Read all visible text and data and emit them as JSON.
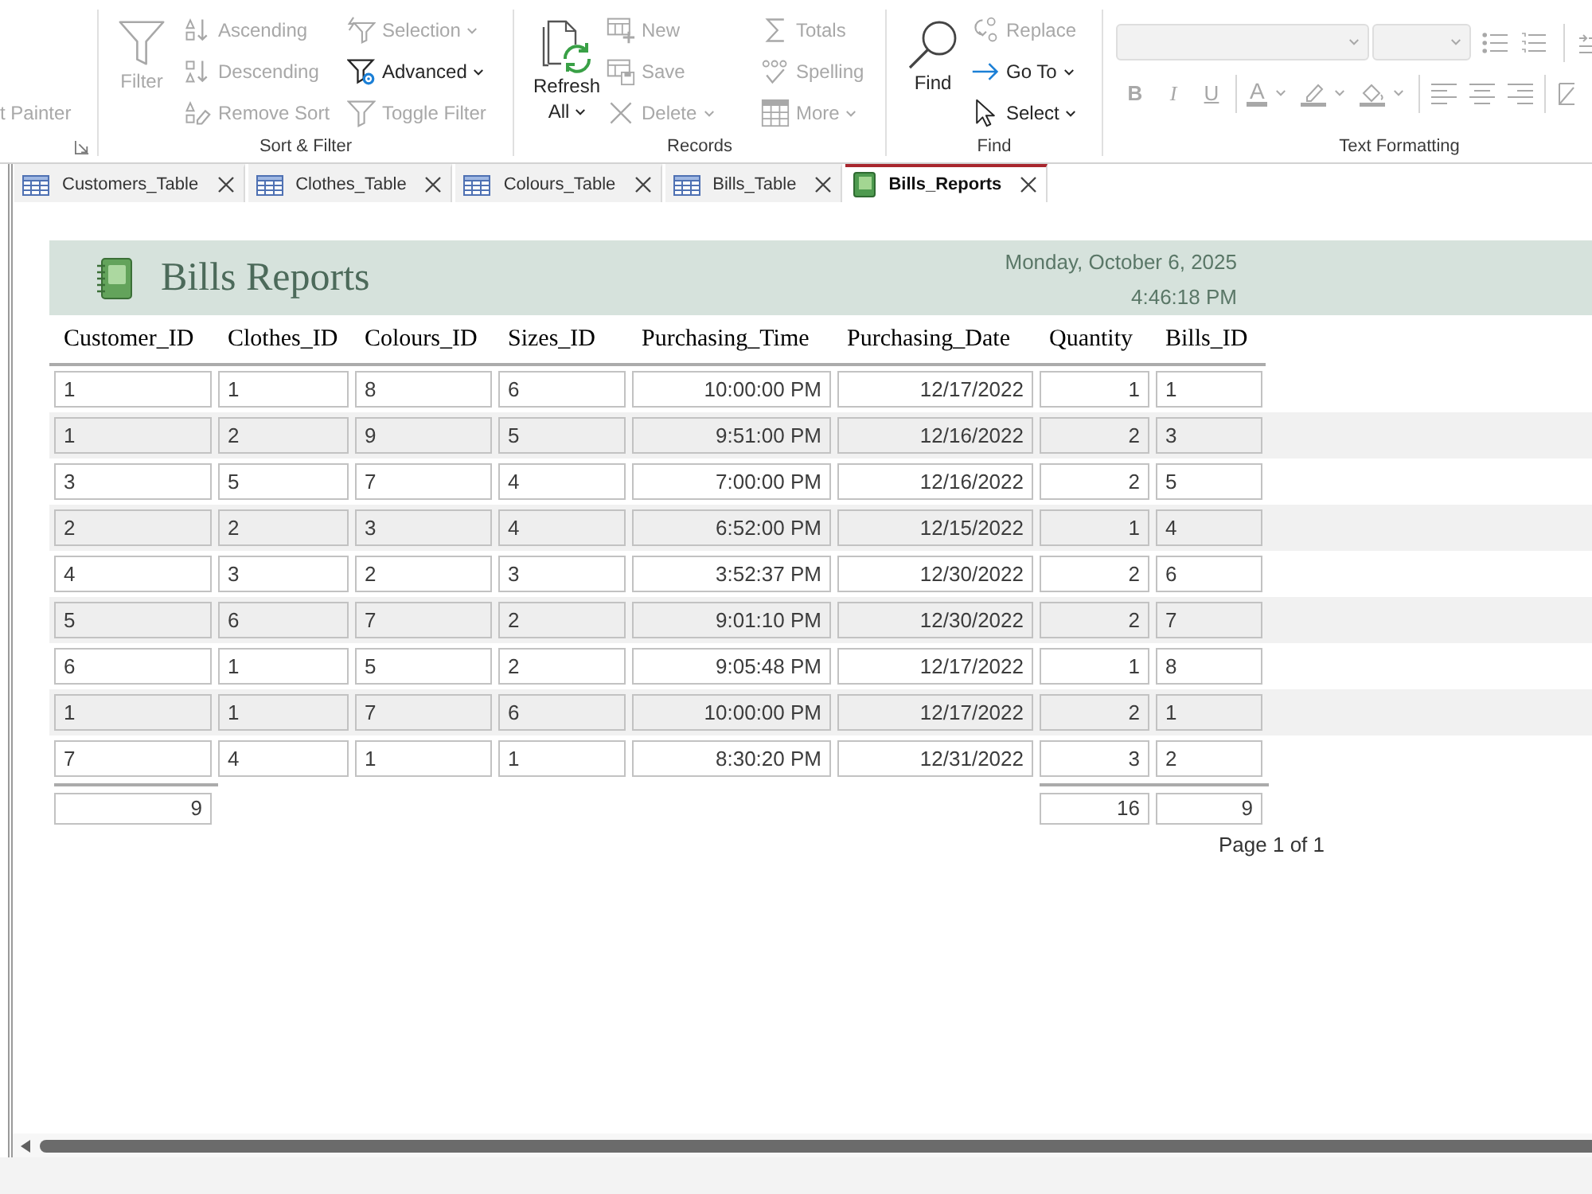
{
  "ribbon": {
    "groups": [
      {
        "kind": "clipped",
        "launcher": true,
        "columns": [
          [
            {
              "label": "t Painter",
              "disabled": true,
              "dropdown": false
            }
          ]
        ]
      },
      {
        "kind": "commands",
        "label": "Sort & Filter",
        "large": {
          "label": "Filter",
          "disabled": true,
          "dropdown": false
        },
        "columns": [
          [
            {
              "label": "Ascending",
              "disabled": true,
              "dropdown": false
            },
            {
              "label": "Descending",
              "disabled": true,
              "dropdown": false
            },
            {
              "label": "Remove Sort",
              "disabled": true,
              "dropdown": false
            }
          ],
          [
            {
              "label": "Selection",
              "disabled": true,
              "dropdown": true
            },
            {
              "label": "Advanced",
              "disabled": false,
              "dropdown": true
            },
            {
              "label": "Toggle Filter",
              "disabled": true,
              "dropdown": false
            }
          ]
        ]
      },
      {
        "kind": "commands",
        "label": "Records",
        "large": {
          "label": "Refresh All",
          "disabled": false,
          "dropdown": true
        },
        "columns": [
          [
            {
              "label": "New",
              "disabled": true,
              "dropdown": false
            },
            {
              "label": "Save",
              "disabled": true,
              "dropdown": false
            },
            {
              "label": "Delete",
              "disabled": true,
              "dropdown": true
            }
          ],
          [
            {
              "label": "Totals",
              "disabled": true,
              "dropdown": false
            },
            {
              "label": "Spelling",
              "disabled": true,
              "dropdown": false
            },
            {
              "label": "More",
              "disabled": true,
              "dropdown": true
            }
          ]
        ]
      },
      {
        "kind": "commands",
        "label": "Find",
        "large": {
          "label": "Find",
          "disabled": false,
          "dropdown": false
        },
        "columns": [
          [
            {
              "label": "Replace",
              "disabled": true,
              "dropdown": false
            },
            {
              "label": "Go To",
              "disabled": false,
              "dropdown": true
            },
            {
              "label": "Select",
              "disabled": false,
              "dropdown": true
            }
          ]
        ]
      },
      {
        "kind": "formatting",
        "label": "Text Formatting",
        "disabled": true,
        "styles": [
          "B",
          "I",
          "U"
        ],
        "font_color": "A"
      }
    ]
  },
  "tabs": [
    {
      "label": "Customers_Table",
      "kind": "table",
      "selected": false
    },
    {
      "label": "Clothes_Table",
      "kind": "table",
      "selected": false
    },
    {
      "label": "Colours_Table",
      "kind": "table",
      "selected": false
    },
    {
      "label": "Bills_Table",
      "kind": "table",
      "selected": false
    },
    {
      "label": "Bills_Reports",
      "kind": "report",
      "selected": true
    }
  ],
  "report": {
    "title": "Bills Reports",
    "date": "Monday, October 6, 2025",
    "time": "4:46:18 PM",
    "columns": [
      {
        "label": "Customer_ID",
        "total": "9"
      },
      {
        "label": "Clothes_ID"
      },
      {
        "label": "Colours_ID"
      },
      {
        "label": "Sizes_ID"
      },
      {
        "label": "Purchasing_Time"
      },
      {
        "label": "Purchasing_Date"
      },
      {
        "label": "Quantity",
        "total": "16"
      },
      {
        "label": "Bills_ID",
        "total": "9"
      }
    ],
    "rows": [
      [
        "1",
        "1",
        "8",
        "6",
        "10:00:00 PM",
        "12/17/2022",
        "1",
        "1"
      ],
      [
        "1",
        "2",
        "9",
        "5",
        "9:51:00 PM",
        "12/16/2022",
        "2",
        "3"
      ],
      [
        "3",
        "5",
        "7",
        "4",
        "7:00:00 PM",
        "12/16/2022",
        "2",
        "5"
      ],
      [
        "2",
        "2",
        "3",
        "4",
        "6:52:00 PM",
        "12/15/2022",
        "1",
        "4"
      ],
      [
        "4",
        "3",
        "2",
        "3",
        "3:52:37 PM",
        "12/30/2022",
        "2",
        "6"
      ],
      [
        "5",
        "6",
        "7",
        "2",
        "9:01:10 PM",
        "12/30/2022",
        "2",
        "7"
      ],
      [
        "6",
        "1",
        "5",
        "2",
        "9:05:48 PM",
        "12/17/2022",
        "1",
        "8"
      ],
      [
        "1",
        "1",
        "7",
        "6",
        "10:00:00 PM",
        "12/17/2022",
        "2",
        "1"
      ],
      [
        "7",
        "4",
        "1",
        "1",
        "8:30:20 PM",
        "12/31/2022",
        "3",
        "2"
      ]
    ],
    "footer": "Page 1 of 1"
  }
}
